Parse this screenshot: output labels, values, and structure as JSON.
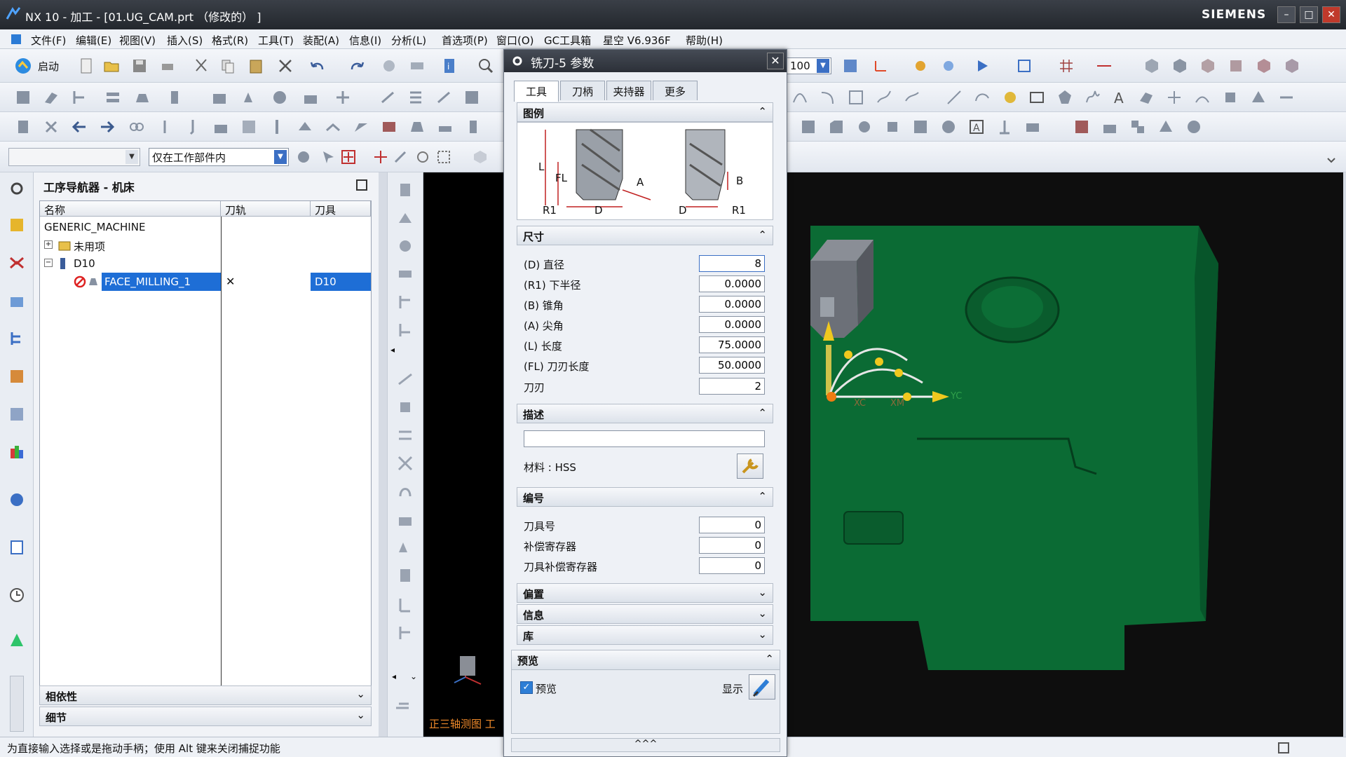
{
  "window": {
    "title": "NX 10 - 加工 - [01.UG_CAM.prt （修改的） ]",
    "brand": "SIEMENS"
  },
  "menu": [
    "文件(F)",
    "编辑(E)",
    "视图(V)",
    "插入(S)",
    "格式(R)",
    "工具(T)",
    "装配(A)",
    "信息(I)",
    "分析(L)",
    "首选项(P)",
    "窗口(O)",
    "GC工具箱",
    "星空 V6.936F",
    "帮助(H)"
  ],
  "toolbar": {
    "start_label": "启动",
    "filter_value": "仅在工作部件内",
    "zoom_value": "100"
  },
  "navigator": {
    "title": "工序导航器 - 机床",
    "columns": [
      "名称",
      "刀轨",
      "刀具"
    ],
    "rows": [
      {
        "name": "GENERIC_MACHINE",
        "path": "",
        "tool": ""
      },
      {
        "name": "未用项",
        "path": "",
        "tool": ""
      },
      {
        "name": "D10",
        "path": "",
        "tool": ""
      },
      {
        "name": "FACE_MILLING_1",
        "path": "✕",
        "tool": "D10"
      }
    ],
    "panel_dependency": "相依性",
    "panel_detail": "细节"
  },
  "status": {
    "message": "为直接输入选择或是拖动手柄；使用 Alt 键来关闭捕捉功能"
  },
  "viewport": {
    "view_label": "正三轴测图 工",
    "axis_labels": [
      "XC",
      "XM",
      "YC"
    ]
  },
  "dialog": {
    "title": "铣刀-5 参数",
    "tabs": [
      "工具",
      "刀柄",
      "夹持器",
      "更多"
    ],
    "legend_title": "图例",
    "legend_labels": {
      "L": "L",
      "FL": "FL",
      "R1": "R1",
      "D": "D",
      "A": "A",
      "B": "B"
    },
    "size_title": "尺寸",
    "fields": [
      {
        "label": "(D) 直径",
        "value": "8"
      },
      {
        "label": "(R1) 下半径",
        "value": "0.0000"
      },
      {
        "label": "(B) 锥角",
        "value": "0.0000"
      },
      {
        "label": "(A) 尖角",
        "value": "0.0000"
      },
      {
        "label": "(L) 长度",
        "value": "75.0000"
      },
      {
        "label": "(FL) 刀刃长度",
        "value": "50.0000"
      },
      {
        "label": "刀刃",
        "value": "2"
      }
    ],
    "desc_title": "描述",
    "desc_value": "",
    "material": "材料 : HSS",
    "numbering_title": "编号",
    "numbering": [
      {
        "label": "刀具号",
        "value": "0"
      },
      {
        "label": "补偿寄存器",
        "value": "0"
      },
      {
        "label": "刀具补偿寄存器",
        "value": "0"
      }
    ],
    "offset_title": "偏置",
    "info_title": "信息",
    "library_title": "库",
    "preview_title": "预览",
    "preview_check": "预览",
    "show_label": "显示"
  },
  "colors": {
    "model_green": "#0b6b34",
    "selection_blue": "#1e6ed6",
    "viewport_bg": "#000000"
  }
}
